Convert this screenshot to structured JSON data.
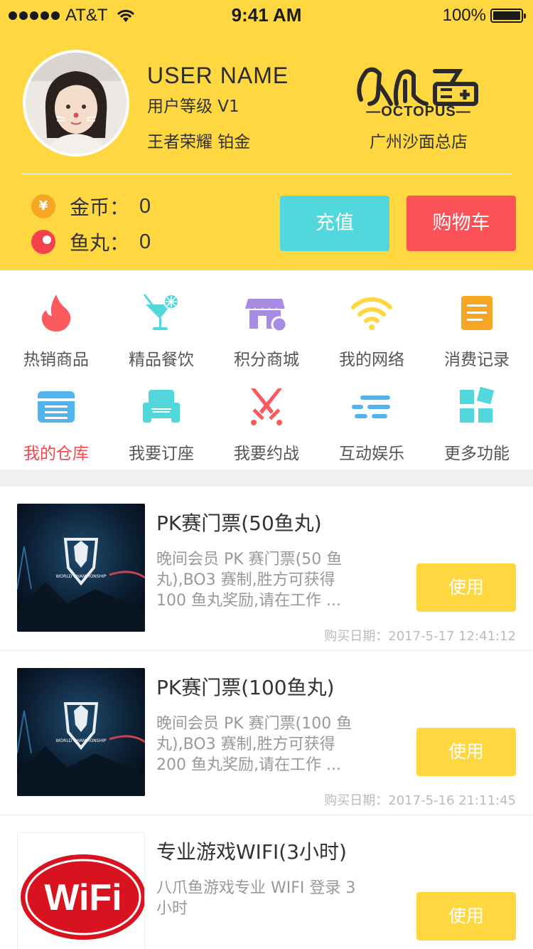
{
  "status_bar": {
    "carrier": "AT&T",
    "time": "9:41 AM",
    "battery": "100%"
  },
  "profile": {
    "user_name": "USER NAME",
    "user_level": "用户等级  V1",
    "game_rank": "王者荣耀  铂金",
    "brand_text": "OCTOPUS",
    "store_name": "广州沙面总店"
  },
  "wallet": {
    "coin_label": "金币：",
    "coin_value": "0",
    "coin_symbol": "¥",
    "fish_label": "鱼丸：",
    "fish_value": "0"
  },
  "actions": {
    "recharge": "充值",
    "cart": "购物车"
  },
  "menu": [
    {
      "label": "热销商品",
      "icon": "flame-icon"
    },
    {
      "label": "精品餐饮",
      "icon": "cocktail-icon"
    },
    {
      "label": "积分商城",
      "icon": "store-icon"
    },
    {
      "label": "我的网络",
      "icon": "wifi-icon"
    },
    {
      "label": "消费记录",
      "icon": "receipt-icon"
    },
    {
      "label": "我的仓库",
      "icon": "warehouse-icon",
      "active": true
    },
    {
      "label": "我要订座",
      "icon": "sofa-icon"
    },
    {
      "label": "我要约战",
      "icon": "swords-icon"
    },
    {
      "label": "互动娱乐",
      "icon": "entertainment-icon"
    },
    {
      "label": "更多功能",
      "icon": "grid-icon"
    }
  ],
  "items": [
    {
      "title": "PK赛门票(50鱼丸)",
      "desc": "晚间会员 PK 赛门票(50 鱼丸),BO3 赛制,胜方可获得 100 鱼丸奖励,请在工作 ...",
      "date": "购买日期：2017-5-17   12:41:12",
      "button": "使用",
      "thumb_text": "WORLD CHAMPIONSHIP"
    },
    {
      "title": "PK赛门票(100鱼丸)",
      "desc": "晚间会员 PK 赛门票(100 鱼丸),BO3 赛制,胜方可获得 200 鱼丸奖励,请在工作 ...",
      "date": "购买日期：2017-5-16   21:11:45",
      "button": "使用",
      "thumb_text": "WORLD CHAMPIONSHIP"
    },
    {
      "title": "专业游戏WIFI(3小时)",
      "desc": "八爪鱼游戏专业 WIFI 登录 3 小时",
      "button": "使用",
      "thumb_text": "WiFi"
    }
  ],
  "colors": {
    "header": "#FFD740",
    "recharge": "#52D8DC",
    "cart": "#FA5257",
    "active": "#F2484E",
    "use_button": "#FFD740"
  }
}
